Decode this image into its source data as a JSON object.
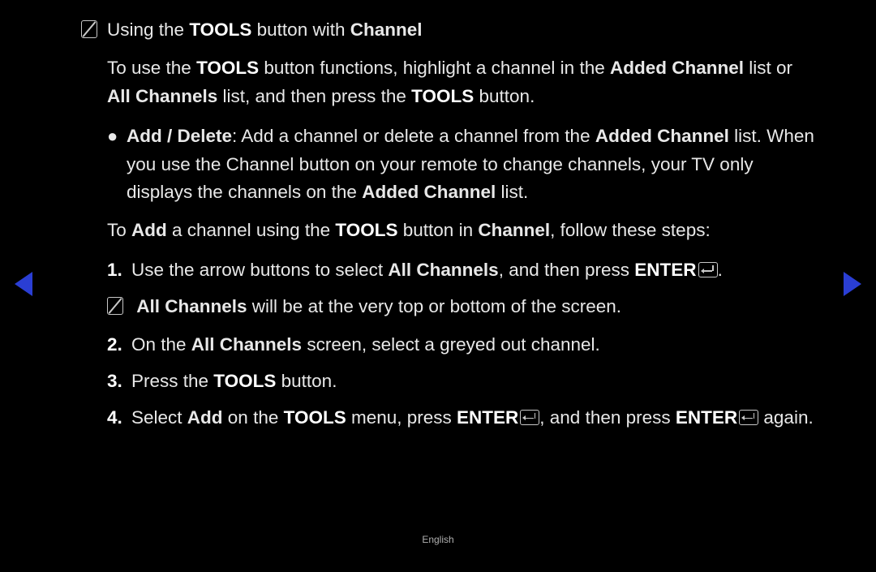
{
  "title": {
    "prefix": "Using the ",
    "bold": "TOOLS",
    "mid": " button with ",
    "link": "Channel"
  },
  "intro": {
    "p1a": "To use the ",
    "p1b": "TOOLS",
    "p1c": " button functions, highlight a channel in the ",
    "p1d": "Added Channel",
    "p1e": " list or ",
    "p1f": "All Channels",
    "p1g": " list, and then press the ",
    "p1h": "TOOLS",
    "p1i": " button."
  },
  "bullet": {
    "b1": "Add / Delete",
    "b2": ": Add a channel or delete a channel from the ",
    "b3": "Added Channel",
    "b4": " list. When you use the Channel button on your remote to change channels, your TV only displays the channels on the ",
    "b5": "Added Channel",
    "b6": " list."
  },
  "lead": {
    "a": "To ",
    "b": "Add",
    "c": " a channel using the ",
    "d": "TOOLS",
    "e": " button in ",
    "f": "Channel",
    "g": ", follow these steps:"
  },
  "steps": {
    "s1a": "Use the arrow buttons to select ",
    "s1b": "All Channels",
    "s1c": ", and then press ",
    "s1d": "ENTER",
    "s1e": ".",
    "note_a": "All Channels",
    "note_b": " will be at the very top or bottom of the screen.",
    "s2a": "On the ",
    "s2b": "All Channels",
    "s2c": " screen, select a greyed out channel.",
    "s3a": "Press the ",
    "s3b": "TOOLS",
    "s3c": " button.",
    "s4a": "Select ",
    "s4b": "Add",
    "s4c": " on the ",
    "s4d": "TOOLS",
    "s4e": " menu, press ",
    "s4f": "ENTER",
    "s4g": ", and then press ",
    "s4h": "ENTER",
    "s4i": " again."
  },
  "nums": {
    "n1": "1.",
    "n2": "2.",
    "n3": "3.",
    "n4": "4."
  },
  "footer": "English"
}
